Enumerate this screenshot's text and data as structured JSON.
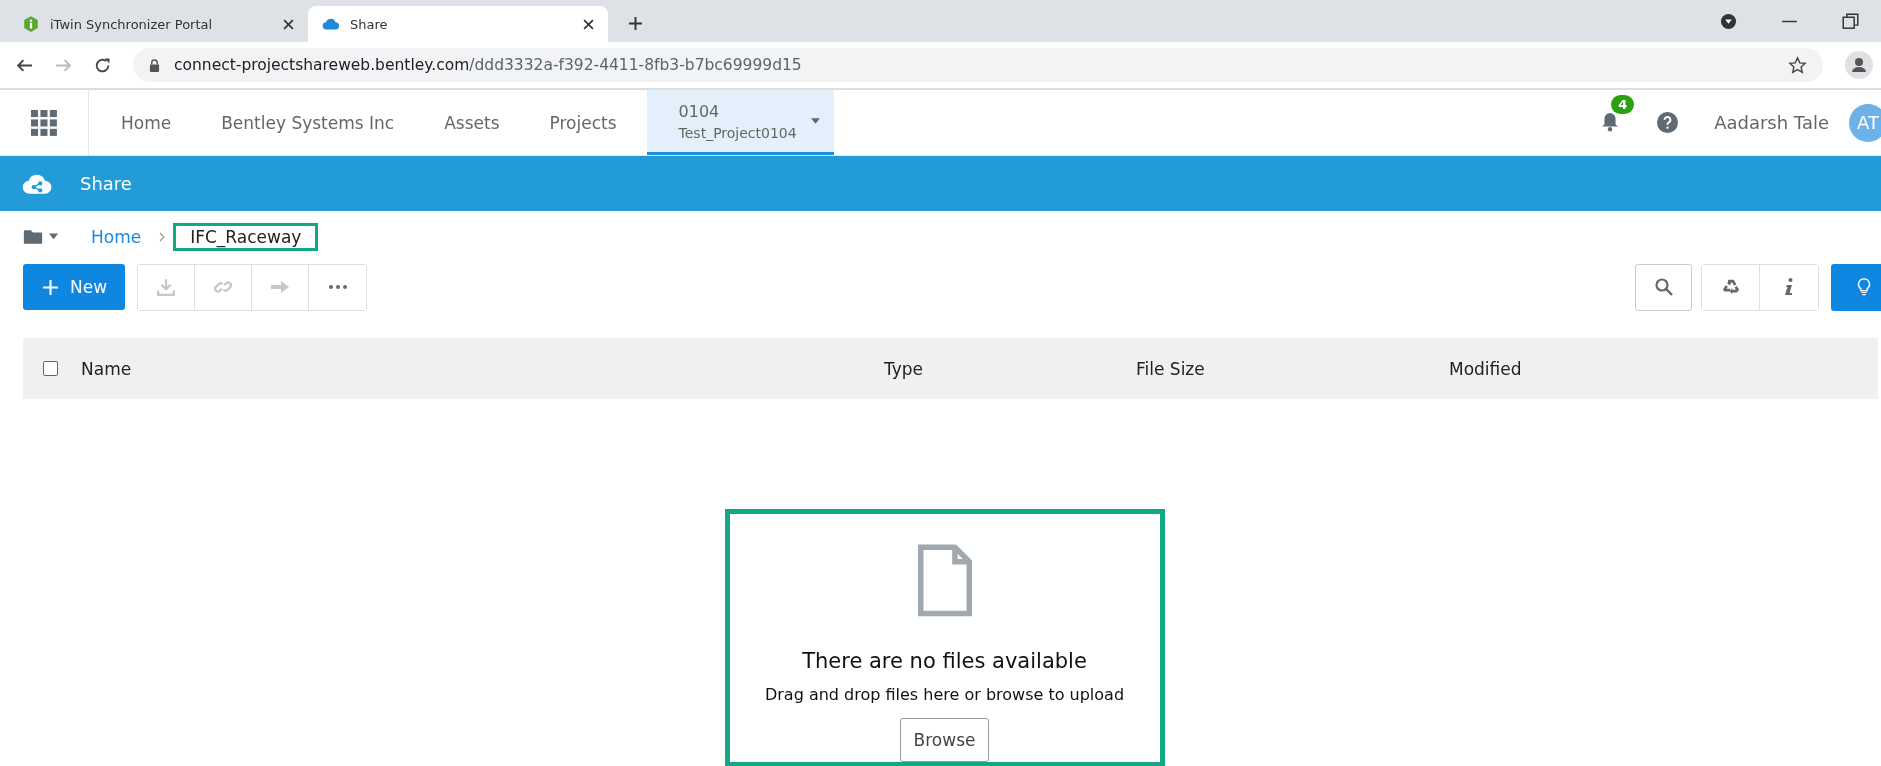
{
  "browser_tabs": [
    {
      "title": "iTwin Synchronizer Portal",
      "selected": false
    },
    {
      "title": "Share",
      "selected": true
    }
  ],
  "address_bar": {
    "host": "connect-projectshareweb.bentley.com",
    "path": "/ddd3332a-f392-4411-8fb3-b7bc69999d15"
  },
  "nav_items": [
    "Home",
    "Bentley Systems Inc",
    "Assets",
    "Projects"
  ],
  "project": {
    "number": "0104",
    "name": "Test_Project0104"
  },
  "notification_count": "4",
  "user_name": "Aadarsh Tale",
  "avatar_initials": "AT",
  "app_title": "Share",
  "breadcrumb": [
    "Home",
    "IFC_Raceway"
  ],
  "new_button": "New",
  "table": {
    "columns": [
      "Name",
      "Type",
      "File Size",
      "Modified"
    ],
    "select_all_checked": false
  },
  "empty_state": {
    "title": "There are no files available",
    "message": "Drag and drop files here or browse to upload",
    "button": "Browse"
  }
}
